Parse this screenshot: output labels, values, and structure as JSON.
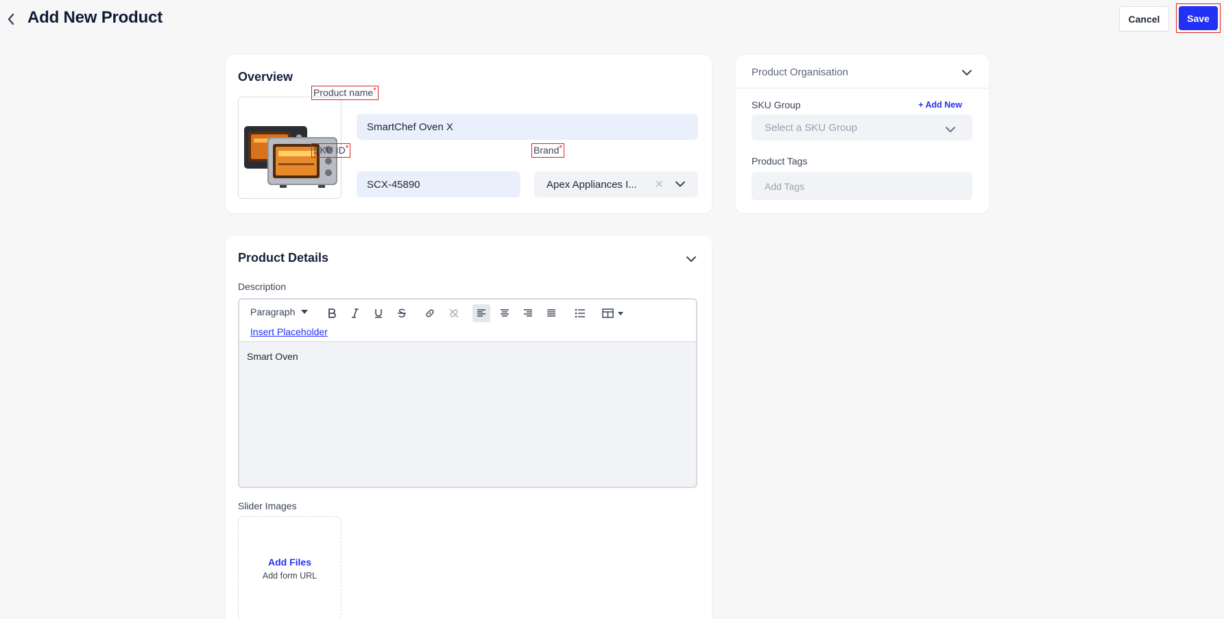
{
  "header": {
    "title": "Add New Product",
    "cancel_label": "Cancel",
    "save_label": "Save"
  },
  "overview": {
    "title": "Overview",
    "product_name_label": "Product name",
    "product_name_value": "SmartChef Oven X",
    "sku_label": "SKU ID",
    "sku_value": "SCX-45890",
    "brand_label": "Brand",
    "brand_value": "Apex Appliances I...",
    "required_mark": "*"
  },
  "organisation": {
    "title": "Product Organisation",
    "sku_group_label": "SKU Group",
    "add_new_label": "+ Add New",
    "sku_group_placeholder": "Select a SKU Group",
    "tags_label": "Product Tags",
    "tags_placeholder": "Add Tags"
  },
  "details": {
    "title": "Product Details",
    "description_label": "Description",
    "toolbar": {
      "paragraph_label": "Paragraph",
      "insert_placeholder_label": "Insert Placeholder"
    },
    "description_value": "Smart Oven",
    "slider_images_label": "Slider Images",
    "add_files_label": "Add Files",
    "add_url_label": "Add form URL"
  },
  "colors": {
    "accent": "#2231f5",
    "required": "#e02020",
    "input_bg": "#e9f0fb"
  }
}
